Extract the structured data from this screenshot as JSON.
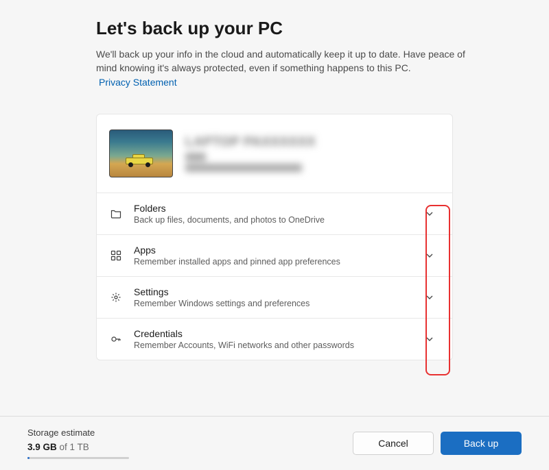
{
  "header": {
    "title": "Let's back up your PC",
    "description": "We'll back up your info in the cloud and automatically keep it up to date. Have peace of mind knowing it's always protected, even if something happens to this PC.",
    "privacy_link": "Privacy Statement"
  },
  "device": {
    "name": "LAPTOP PAXXXXXX",
    "sub2_placeholder": "Last backup March XX XXXX"
  },
  "options": [
    {
      "icon": "folder-icon",
      "title": "Folders",
      "subtitle": "Back up files, documents, and photos to OneDrive"
    },
    {
      "icon": "apps-icon",
      "title": "Apps",
      "subtitle": "Remember installed apps and pinned app preferences"
    },
    {
      "icon": "settings-icon",
      "title": "Settings",
      "subtitle": "Remember Windows settings and preferences"
    },
    {
      "icon": "credentials-icon",
      "title": "Credentials",
      "subtitle": "Remember Accounts, WiFi networks and other passwords"
    }
  ],
  "footer": {
    "storage_label": "Storage estimate",
    "storage_used": "3.9 GB",
    "storage_of": " of 1 TB",
    "cancel": "Cancel",
    "backup": "Back up"
  }
}
